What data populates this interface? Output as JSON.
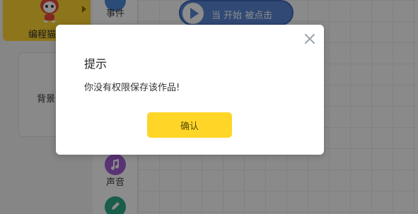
{
  "sprite_panel": {
    "sprite_name": "编程猫",
    "sprite_name_suffix": "…",
    "background_label": "背景"
  },
  "categories": [
    {
      "label": "事件",
      "color": "#4f8ad9",
      "icon": "event-icon"
    },
    {
      "label": "声音",
      "color": "#a45ed6",
      "icon": "music-note-icon"
    },
    {
      "label": "",
      "color": "#2ea989",
      "icon": "pen-icon"
    }
  ],
  "stage": {
    "start_block_label": "当 开始 被点击",
    "start_block_color": "#5a86d6"
  },
  "dialog": {
    "title": "提示",
    "message": "你没有权限保存该作品!",
    "confirm_label": "确认",
    "confirm_color": "#ffd628"
  }
}
